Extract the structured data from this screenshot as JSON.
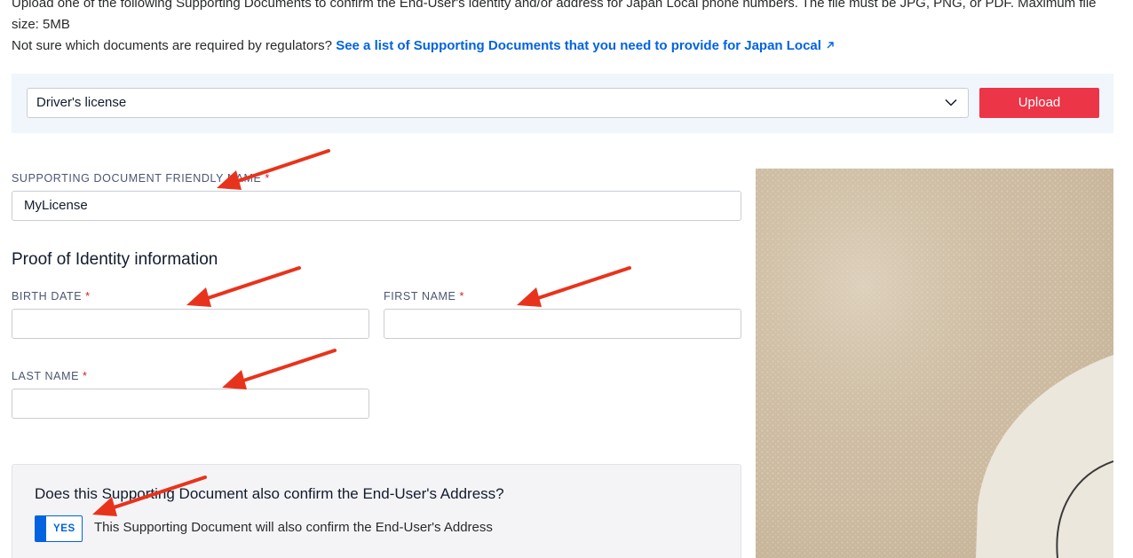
{
  "intro": {
    "line1": "Upload one of the following Supporting Documents to confirm the End-User's identity and/or address for Japan Local phone numbers. The file must be JPG, PNG, or PDF. Maximum file",
    "line2": "size: 5MB",
    "question": "Not sure which documents are required by regulators?",
    "link_text": "See a list of Supporting Documents that you need to provide for Japan Local",
    "link_icon": "external-link-icon"
  },
  "upload_bar": {
    "selected_document_type": "Driver's license",
    "select_icon": "chevron-down-icon",
    "upload_label": "Upload",
    "upload_color": "#ec3547"
  },
  "friendly_name": {
    "label": "SUPPORTING DOCUMENT FRIENDLY NAME",
    "required_marker": "*",
    "value": "MyLicense"
  },
  "proof_of_identity": {
    "title": "Proof of Identity information",
    "birth_date": {
      "label": "BIRTH DATE",
      "required_marker": "*",
      "value": ""
    },
    "first_name": {
      "label": "FIRST NAME",
      "required_marker": "*",
      "value": ""
    },
    "last_name": {
      "label": "LAST NAME",
      "required_marker": "*",
      "value": ""
    }
  },
  "address_confirm": {
    "question": "Does this Supporting Document also confirm the End-User's Address?",
    "toggle_label": "YES",
    "toggle_state": "on",
    "toggle_text": "This Supporting Document will also confirm the End-User's Address"
  },
  "annotations": {
    "arrow_color": "#e8331c"
  },
  "colors": {
    "link": "#0263e0",
    "required": "#d61f1f",
    "panel_background": "#f0f6fc"
  }
}
